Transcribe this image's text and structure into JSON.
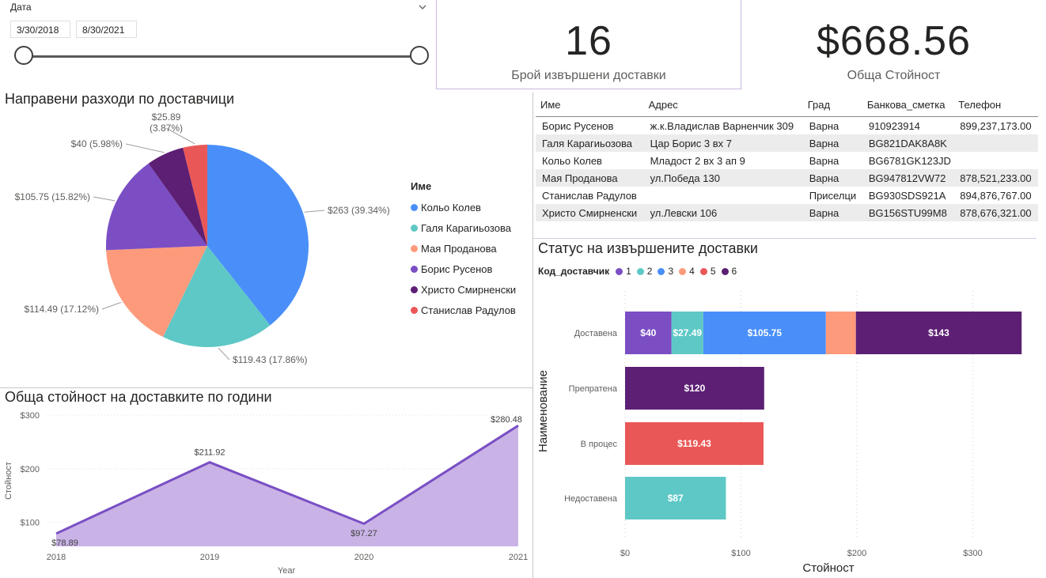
{
  "slicer": {
    "title": "Дата",
    "start": "3/30/2018",
    "end": "8/30/2021"
  },
  "kpis": {
    "count_value": "16",
    "count_label": "Брой извършени доставки",
    "total_value": "$668.56",
    "total_label": "Обща Стойност"
  },
  "pie": {
    "title": "Направени разходи по доставчици",
    "legend_title": "Име"
  },
  "table": {
    "headers": [
      "Име",
      "Адрес",
      "Град",
      "Банкова_сметка",
      "Телефон"
    ],
    "rows": [
      [
        "Борис Русенов",
        "ж.к.Владислав Варненчик 309",
        "Варна",
        "910923914",
        "899,237,173.00"
      ],
      [
        "Галя Карагиьозова",
        "Цар Борис 3 вх 7",
        "Варна",
        "BG821DAK8A8K",
        ""
      ],
      [
        "Кольо Колев",
        "Младост 2 вх 3 ап 9",
        "Варна",
        "BG6781GK123JD",
        ""
      ],
      [
        "Мая Проданова",
        "ул.Победа 130",
        "Варна",
        "BG947812VW72",
        "878,521,233.00"
      ],
      [
        "Станислав Радулов",
        "",
        "Приселци",
        "BG930SDS921A",
        "894,876,767.00"
      ],
      [
        "Христо Смирненски",
        "ул.Левски 106",
        "Варна",
        "BG156STU99M8",
        "878,676,321.00"
      ]
    ]
  },
  "area": {
    "title": "Обща стойност на доставките по години"
  },
  "bars": {
    "title": "Статус на извършените доставки",
    "legend_title": "Код_доставчик"
  },
  "colors": {
    "blue": "#4a8ff9",
    "teal": "#5ec8c6",
    "salmon": "#fd9a7c",
    "purple": "#7b4ec4",
    "dark_purple": "#5c1f73",
    "red": "#ea5757",
    "area_fill": "#c9b3e6",
    "area_line": "#7a4fc4"
  },
  "chart_data": [
    {
      "type": "pie",
      "legend_title": "Име",
      "slices": [
        {
          "name": "Кольо Колев",
          "value": 263,
          "label": "$263 (39.34%)",
          "color": "#4a8ff9"
        },
        {
          "name": "Галя Карагиьозова",
          "value": 119.43,
          "label": "$119.43 (17.86%)",
          "color": "#5ec8c6"
        },
        {
          "name": "Мая Проданова",
          "value": 114.49,
          "label": "$114.49 (17.12%)",
          "color": "#fd9a7c"
        },
        {
          "name": "Борис Русенов",
          "value": 105.75,
          "label": "$105.75 (15.82%)",
          "color": "#7b4ec4"
        },
        {
          "name": "Христо Смирненски",
          "value": 40,
          "label": "$40 (5.98%)",
          "color": "#5c1f73"
        },
        {
          "name": "Станислав Радулов",
          "value": 25.89,
          "label_line1": "$25.89",
          "label_line2": "(3.87%)",
          "color": "#ea5757"
        }
      ]
    },
    {
      "type": "area",
      "title": "Обща стойност на доставките по години",
      "xlabel": "Year",
      "ylabel": "Стойност",
      "x": [
        "2018",
        "2019",
        "2020",
        "2021"
      ],
      "values": [
        78.89,
        211.92,
        97.27,
        280.48
      ],
      "value_labels": [
        "$78.89",
        "$211.92",
        "$97.27",
        "$280.48"
      ],
      "y_ticks": [
        100,
        200,
        300
      ],
      "y_tick_labels": [
        "$100",
        "$200",
        "$300"
      ],
      "ylim": [
        55,
        300
      ]
    },
    {
      "type": "bar",
      "orientation": "horizontal",
      "stacked": true,
      "title": "Статус на извършените доставки",
      "xlabel": "Стойност",
      "ylabel": "Наименование",
      "legend_title": "Код_доставчик",
      "legend": [
        {
          "name": "1",
          "color": "#7b4ec4"
        },
        {
          "name": "2",
          "color": "#5ec8c6"
        },
        {
          "name": "3",
          "color": "#4a8ff9"
        },
        {
          "name": "4",
          "color": "#fd9a7c"
        },
        {
          "name": "5",
          "color": "#ea5757"
        },
        {
          "name": "6",
          "color": "#5c1f73"
        }
      ],
      "categories": [
        "Доставена",
        "Препратена",
        "В процес",
        "Недоставена"
      ],
      "segments": [
        [
          {
            "code": "1",
            "value": 40,
            "label": "$40"
          },
          {
            "code": "2",
            "value": 27.49,
            "label": "$27.49"
          },
          {
            "code": "3",
            "value": 105.75,
            "label": "$105.75"
          },
          {
            "code": "4",
            "value": 25.89,
            "label": ""
          },
          {
            "code": "6",
            "value": 143,
            "label": "$143"
          }
        ],
        [
          {
            "code": "6",
            "value": 120,
            "label": "$120"
          }
        ],
        [
          {
            "code": "5",
            "value": 119.43,
            "label": "$119.43"
          }
        ],
        [
          {
            "code": "2",
            "value": 87,
            "label": "$87"
          }
        ]
      ],
      "x_ticks": [
        0,
        100,
        200,
        300
      ],
      "x_tick_labels": [
        "$0",
        "$100",
        "$200",
        "$300"
      ],
      "xlim": [
        0,
        345
      ]
    }
  ]
}
